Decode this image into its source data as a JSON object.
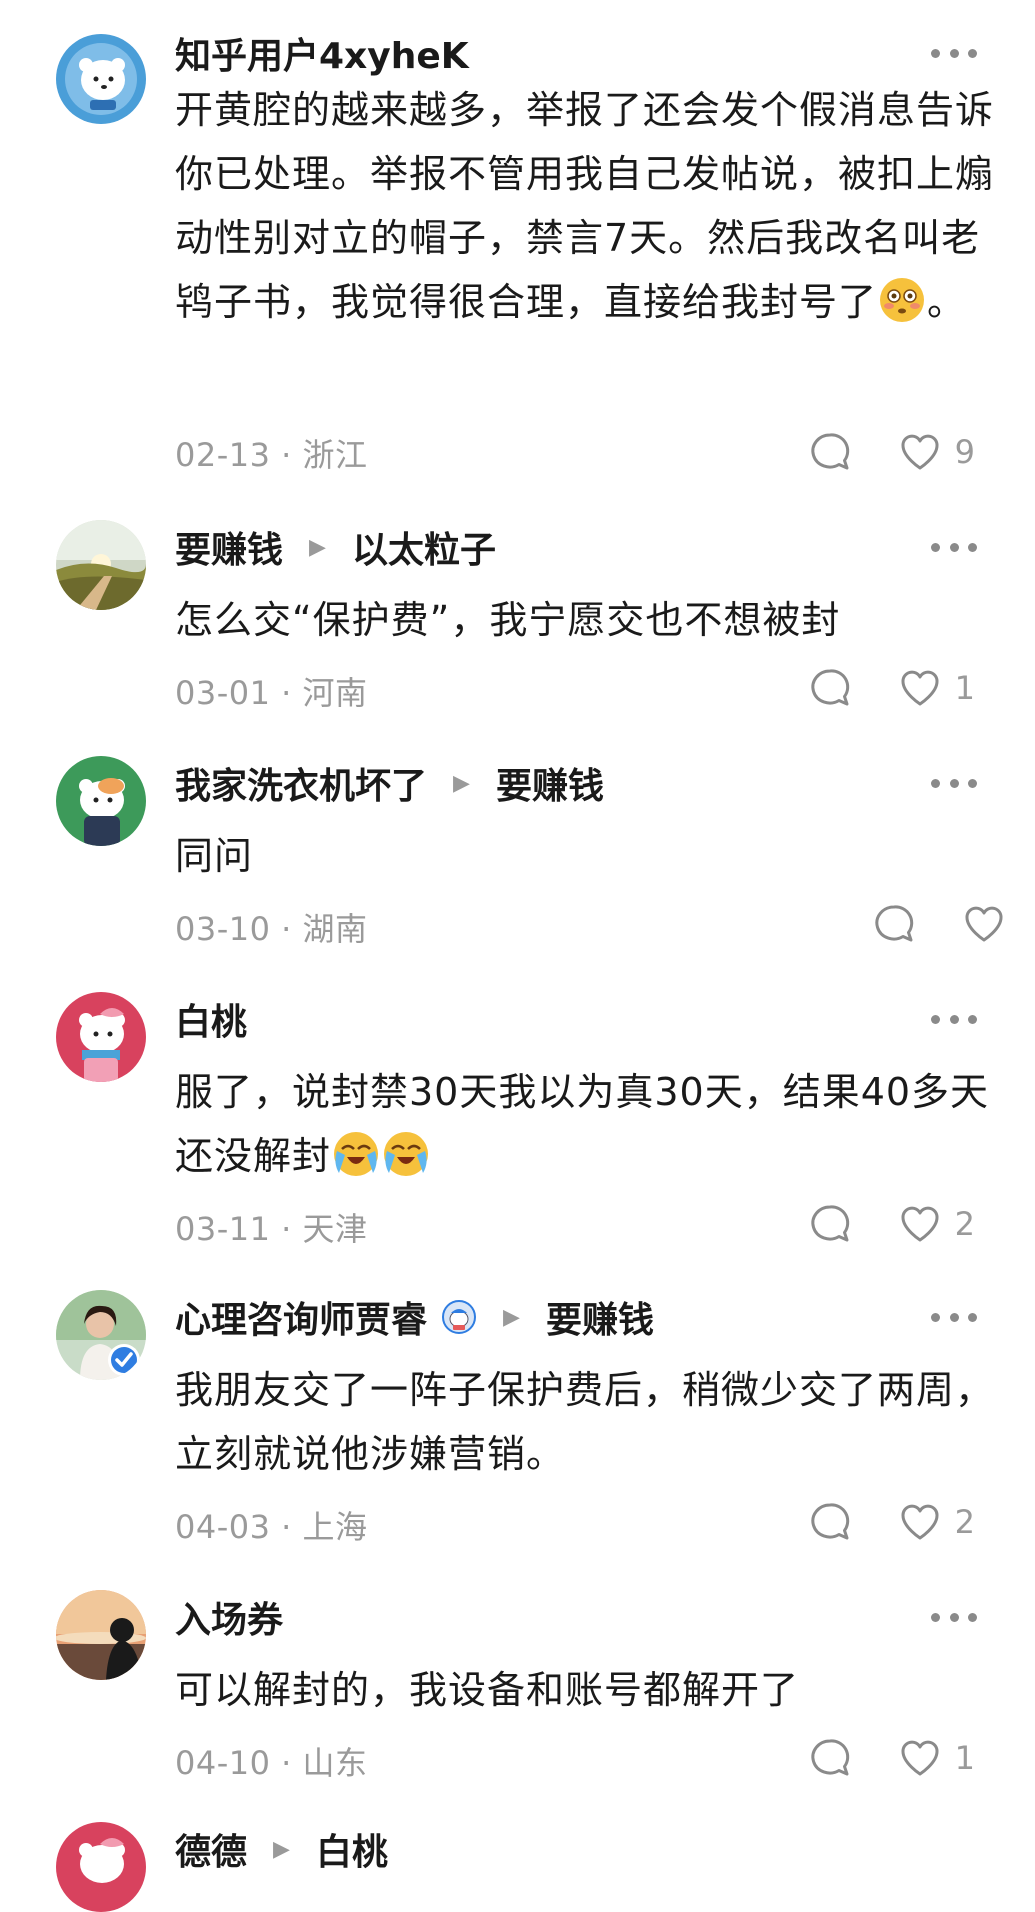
{
  "comments": [
    {
      "author": "知乎用户4xyheK",
      "reply_to": "",
      "text_before_emoji": "开黄腔的越来越多，举报了还会发个假消息告诉你已处理。举报不管用我自己发帖说，被扣上煽动性别对立的帽子，禁言7天。然后我改名叫老鸨子书，我觉得很合理，直接给我封号了",
      "text_after_emoji": "。",
      "emoji": "flushed-face",
      "date": "02-13",
      "location": "浙江",
      "likes": "9"
    },
    {
      "author": "要赚钱",
      "reply_to": "以太粒子",
      "text": "怎么交“保护费”，我宁愿交也不想被封",
      "date": "03-01",
      "location": "河南",
      "likes": "1"
    },
    {
      "author": "我家洗衣机坏了",
      "reply_to": "要赚钱",
      "text": "同问",
      "date": "03-10",
      "location": "湖南",
      "likes": ""
    },
    {
      "author": "白桃",
      "reply_to": "",
      "text": "服了，说封禁30天我以为真30天，结果40多天还没解封",
      "emoji": "loudly-crying-face x2",
      "date": "03-11",
      "location": "天津",
      "likes": "2"
    },
    {
      "author": "心理咨询师贾睿",
      "reply_to": "要赚钱",
      "text": "我朋友交了一阵子保护费后，稍微少交了两周，立刻就说他涉嫌营销。",
      "date": "04-03",
      "location": "上海",
      "likes": "2"
    },
    {
      "author": "入场券",
      "reply_to": "",
      "text": "可以解封的，我设备和账号都解开了",
      "date": "04-10",
      "location": "山东",
      "likes": "1"
    },
    {
      "author": "德德",
      "reply_to": "白桃"
    }
  ],
  "meta_separator": "·",
  "colors": {
    "text": "#1a1a1a",
    "muted": "#9a9a9a",
    "verified_blue": "#2f7de1"
  }
}
